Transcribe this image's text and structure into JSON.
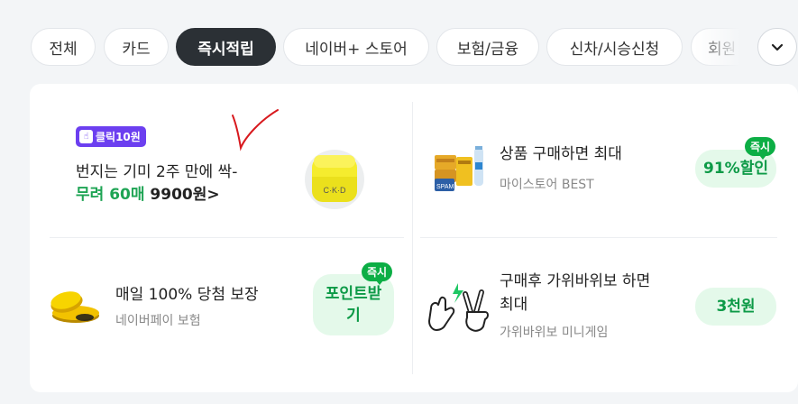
{
  "tabs": [
    {
      "label": "전체",
      "active": false
    },
    {
      "label": "카드",
      "active": false
    },
    {
      "label": "즉시적립",
      "active": true
    },
    {
      "label": "네이버+ 스토어",
      "active": false
    },
    {
      "label": "보험/금융",
      "active": false
    },
    {
      "label": "신차/시승신청",
      "active": false
    },
    {
      "label": "회원",
      "active": false
    }
  ],
  "more_icon": "chevron-down-icon",
  "ad": {
    "badge": "클릭10원",
    "line1": "번지는 기미 2주 만에 싹-",
    "line2_green": "무려 60매",
    "line2_black": "9900원>",
    "product_brand": "C·K·D"
  },
  "items": [
    {
      "title": "상품 구매하면 최대",
      "subtitle": "마이스토어 BEST",
      "action": "91%할인",
      "tag": "즉시"
    },
    {
      "title": "매일 100% 당첨 보장",
      "subtitle": "네이버페이 보험",
      "action_line1": "포인트받",
      "action_line2": "기",
      "tag": "즉시"
    },
    {
      "title_line1": "구매후 가위바위보 하면",
      "title_line2": "최대",
      "subtitle": "가위바위보 미니게임",
      "action": "3천원"
    }
  ],
  "colors": {
    "accent_green": "#0d9a47",
    "pill_bg": "#e4f9ea",
    "tag_green": "#0cae45",
    "active_tab": "#2b3035",
    "click_badge": "#6c3ff0"
  }
}
